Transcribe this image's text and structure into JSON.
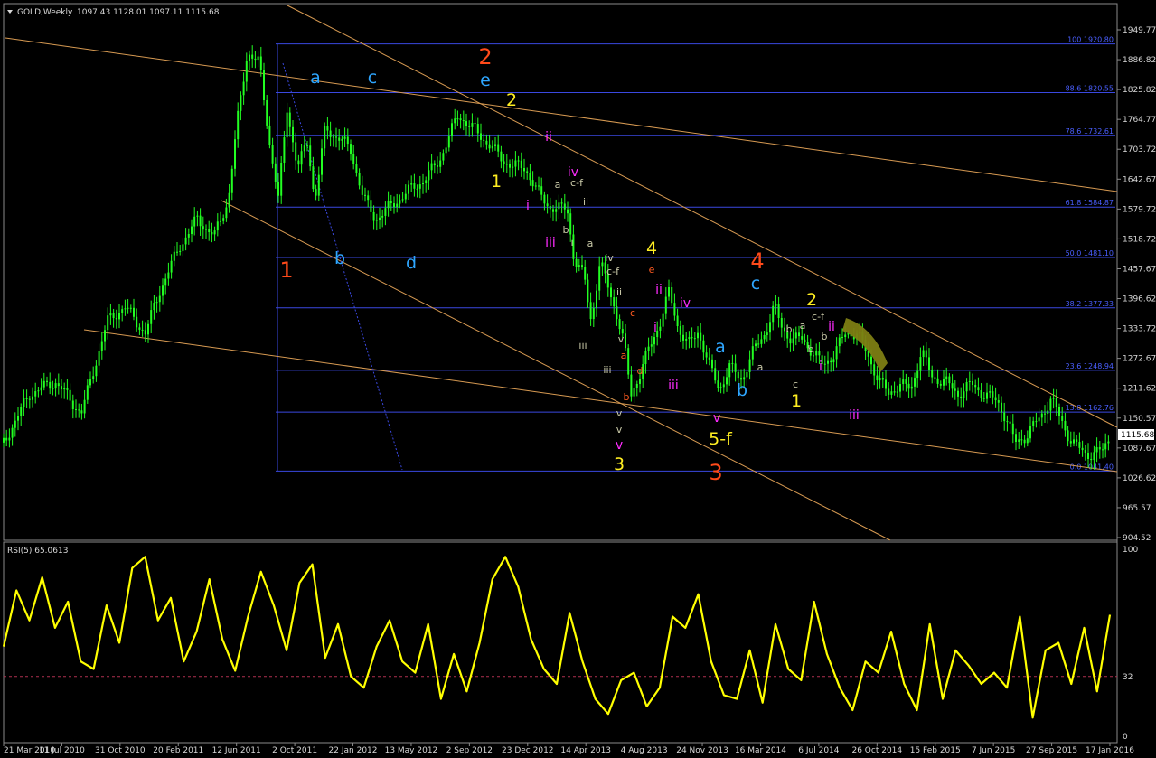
{
  "header": {
    "symbol_title": "GOLD,Weekly",
    "ohlc": "1097.43 1128.01 1097.11 1115.68"
  },
  "rsi_header": "RSI(5) 65.0613",
  "current_price": "1115.68",
  "chart_data": [
    {
      "type": "candlestick",
      "title": "GOLD,Weekly",
      "ylim": [
        904.52,
        1980
      ],
      "y_ticks": [
        "1949.77",
        "1886.82",
        "1825.82",
        "1764.77",
        "1703.72",
        "1642.67",
        "1579.72",
        "1518.72",
        "1457.67",
        "1396.62",
        "1333.72",
        "1272.67",
        "1211.62",
        "1150.57",
        "1087.67",
        "1026.62",
        "965.57",
        "904.52"
      ],
      "x_ticks": [
        "21 Mar 2010",
        "11 Jul 2010",
        "31 Oct 2010",
        "20 Feb 2011",
        "12 Jun 2011",
        "2 Oct 2011",
        "22 Jan 2012",
        "13 May 2012",
        "2 Sep 2012",
        "23 Dec 2012",
        "14 Apr 2013",
        "4 Aug 2013",
        "24 Nov 2013",
        "16 Mar 2014",
        "6 Jul 2014",
        "26 Oct 2014",
        "15 Feb 2015",
        "7 Jun 2015",
        "27 Sep 2015",
        "17 Jan 2016"
      ],
      "price_path": [
        [
          0,
          1100
        ],
        [
          1.5,
          1200
        ],
        [
          3,
          1225
        ],
        [
          4.5,
          1160
        ],
        [
          6,
          1350
        ],
        [
          7,
          1380
        ],
        [
          8.2,
          1325
        ],
        [
          9,
          1410
        ],
        [
          10.2,
          1505
        ],
        [
          11.2,
          1560
        ],
        [
          12.2,
          1525
        ],
        [
          13,
          1600
        ],
        [
          13.5,
          1755
        ],
        [
          14.1,
          1905
        ],
        [
          14.8,
          1880
        ],
        [
          15.4,
          1715
        ],
        [
          15.9,
          1600
        ],
        [
          16.4,
          1790
        ],
        [
          17,
          1665
        ],
        [
          17.6,
          1720
        ],
        [
          18,
          1595
        ],
        [
          18.6,
          1745
        ],
        [
          19.5,
          1725
        ],
        [
          20.1,
          1700
        ],
        [
          20.8,
          1605
        ],
        [
          21.5,
          1560
        ],
        [
          22.5,
          1590
        ],
        [
          23.5,
          1620
        ],
        [
          24.3,
          1640
        ],
        [
          25.2,
          1680
        ],
        [
          26.3,
          1775
        ],
        [
          27.2,
          1745
        ],
        [
          28.2,
          1710
        ],
        [
          28.9,
          1680
        ],
        [
          29.5,
          1670
        ],
        [
          30.2,
          1665
        ],
        [
          30.9,
          1615
        ],
        [
          31.6,
          1585
        ],
        [
          32.2,
          1580
        ],
        [
          32.6,
          1585
        ],
        [
          33,
          1475
        ],
        [
          33.6,
          1440
        ],
        [
          34,
          1350
        ],
        [
          34.5,
          1470
        ],
        [
          35,
          1420
        ],
        [
          35.5,
          1360
        ],
        [
          35.9,
          1300
        ],
        [
          36.3,
          1200
        ],
        [
          36.8,
          1240
        ],
        [
          37.4,
          1300
        ],
        [
          38,
          1350
        ],
        [
          38.5,
          1410
        ],
        [
          39,
          1340
        ],
        [
          39.6,
          1300
        ],
        [
          40.2,
          1330
        ],
        [
          40.8,
          1260
        ],
        [
          41.4,
          1210
        ],
        [
          42,
          1255
        ],
        [
          42.7,
          1230
        ],
        [
          43.4,
          1290
        ],
        [
          44.1,
          1330
        ],
        [
          44.6,
          1380
        ],
        [
          45,
          1340
        ],
        [
          45.6,
          1310
        ],
        [
          46.2,
          1315
        ],
        [
          46.8,
          1285
        ],
        [
          47.4,
          1260
        ],
        [
          48,
          1280
        ],
        [
          48.7,
          1325
        ],
        [
          49.4,
          1325
        ],
        [
          50,
          1280
        ],
        [
          50.6,
          1230
        ],
        [
          51.2,
          1200
        ],
        [
          51.8,
          1220
        ],
        [
          52.5,
          1210
        ],
        [
          53.1,
          1290
        ],
        [
          53.7,
          1235
        ],
        [
          54.5,
          1225
        ],
        [
          55.2,
          1200
        ],
        [
          56,
          1220
        ],
        [
          56.7,
          1200
        ],
        [
          57.5,
          1185
        ],
        [
          58,
          1150
        ],
        [
          58.5,
          1100
        ],
        [
          59.2,
          1115
        ],
        [
          60,
          1155
        ],
        [
          60.6,
          1190
        ],
        [
          61.2,
          1145
        ],
        [
          61.8,
          1100
        ],
        [
          62.5,
          1080
        ],
        [
          63,
          1075
        ],
        [
          63.6,
          1085
        ],
        [
          64,
          1115
        ]
      ],
      "fib_levels": [
        {
          "label": "100 1920.80",
          "price": 1920.8
        },
        {
          "label": "88.6 1820.55",
          "price": 1820.55
        },
        {
          "label": "78.6 1732.61",
          "price": 1732.61
        },
        {
          "label": "61.8 1584.87",
          "price": 1584.87
        },
        {
          "label": "50.0 1481.10",
          "price": 1481.1
        },
        {
          "label": "38.2 1377.33",
          "price": 1377.33
        },
        {
          "label": "23.6 1248.94",
          "price": 1248.94
        },
        {
          "label": "13.8 1162.76",
          "price": 1162.76
        },
        {
          "label": "0.0 1041.40",
          "price": 1041.4
        }
      ],
      "wave_labels": [
        {
          "t": "1",
          "c": "#ff4a1a",
          "s": "big",
          "x": 317,
          "y": 307
        },
        {
          "t": "2",
          "c": "#ff4a1a",
          "s": "big",
          "x": 537,
          "y": 71
        },
        {
          "t": "3",
          "c": "#ff4a1a",
          "s": "big",
          "x": 792,
          "y": 531
        },
        {
          "t": "4",
          "c": "#ff4a1a",
          "s": "big",
          "x": 838,
          "y": 297
        },
        {
          "t": "a",
          "c": "#2ea6ff",
          "s": "med",
          "x": 349,
          "y": 92
        },
        {
          "t": "c",
          "c": "#2ea6ff",
          "s": "med",
          "x": 412,
          "y": 92
        },
        {
          "t": "b",
          "c": "#2ea6ff",
          "s": "med",
          "x": 376,
          "y": 292
        },
        {
          "t": "d",
          "c": "#2ea6ff",
          "s": "med",
          "x": 455,
          "y": 297
        },
        {
          "t": "e",
          "c": "#2ea6ff",
          "s": "med",
          "x": 537,
          "y": 95
        },
        {
          "t": "c",
          "c": "#2ea6ff",
          "s": "med",
          "x": 836,
          "y": 320
        },
        {
          "t": "a",
          "c": "#2ea6ff",
          "s": "med",
          "x": 797,
          "y": 390
        },
        {
          "t": "b",
          "c": "#2ea6ff",
          "s": "med",
          "x": 821,
          "y": 438
        },
        {
          "t": "2",
          "c": "#ffee22",
          "s": "med",
          "x": 566,
          "y": 117
        },
        {
          "t": "1",
          "c": "#ffee22",
          "s": "med",
          "x": 549,
          "y": 207
        },
        {
          "t": "4",
          "c": "#ffee22",
          "s": "med",
          "x": 721,
          "y": 281
        },
        {
          "t": "3",
          "c": "#ffee22",
          "s": "med",
          "x": 685,
          "y": 520
        },
        {
          "t": "5-f",
          "c": "#ffee22",
          "s": "med",
          "x": 797,
          "y": 492
        },
        {
          "t": "2",
          "c": "#ffee22",
          "s": "med",
          "x": 898,
          "y": 338
        },
        {
          "t": "1",
          "c": "#ffee22",
          "s": "med",
          "x": 881,
          "y": 450
        },
        {
          "t": "ii",
          "c": "#ff2bff",
          "s": "n",
          "x": 607,
          "y": 156
        },
        {
          "t": "iv",
          "c": "#ff2bff",
          "s": "n",
          "x": 634,
          "y": 195
        },
        {
          "t": "i",
          "c": "#ff2bff",
          "s": "n",
          "x": 584,
          "y": 232
        },
        {
          "t": "iii",
          "c": "#ff2bff",
          "s": "n",
          "x": 609,
          "y": 273
        },
        {
          "t": "ii",
          "c": "#ff2bff",
          "s": "n",
          "x": 729,
          "y": 325
        },
        {
          "t": "iv",
          "c": "#ff2bff",
          "s": "n",
          "x": 758,
          "y": 340
        },
        {
          "t": "i",
          "c": "#ff2bff",
          "s": "n",
          "x": 725,
          "y": 367
        },
        {
          "t": "iii",
          "c": "#ff2bff",
          "s": "n",
          "x": 745,
          "y": 431
        },
        {
          "t": "v",
          "c": "#ff2bff",
          "s": "n",
          "x": 793,
          "y": 467
        },
        {
          "t": "v",
          "c": "#ff2bff",
          "s": "n",
          "x": 685,
          "y": 497
        },
        {
          "t": "ii",
          "c": "#ff2bff",
          "s": "n",
          "x": 920,
          "y": 366
        },
        {
          "t": "i",
          "c": "#ff2bff",
          "s": "n",
          "x": 908,
          "y": 410
        },
        {
          "t": "iii",
          "c": "#ff2bff",
          "s": "n",
          "x": 945,
          "y": 464
        },
        {
          "t": "a",
          "c": "#ccccaa",
          "s": "sm",
          "x": 617,
          "y": 208
        },
        {
          "t": "c-f",
          "c": "#ccccaa",
          "s": "sm",
          "x": 638,
          "y": 206
        },
        {
          "t": "ii",
          "c": "#ccccaa",
          "s": "sm",
          "x": 648,
          "y": 227
        },
        {
          "t": "b",
          "c": "#ccccaa",
          "s": "sm",
          "x": 626,
          "y": 258
        },
        {
          "t": "i",
          "c": "#ccccaa",
          "s": "sm",
          "x": 633,
          "y": 272
        },
        {
          "t": "a",
          "c": "#ccccaa",
          "s": "sm",
          "x": 653,
          "y": 273
        },
        {
          "t": "iv",
          "c": "#ccccaa",
          "s": "sm",
          "x": 674,
          "y": 289
        },
        {
          "t": "c-f",
          "c": "#ccccaa",
          "s": "sm",
          "x": 678,
          "y": 304
        },
        {
          "t": "ii",
          "c": "#ccccaa",
          "s": "sm",
          "x": 685,
          "y": 327
        },
        {
          "t": "iii",
          "c": "#ccccaa",
          "s": "sm",
          "x": 645,
          "y": 386
        },
        {
          "t": "v",
          "c": "#ccccaa",
          "s": "sm",
          "x": 687,
          "y": 379
        },
        {
          "t": "iii",
          "c": "#ccccaa",
          "s": "sm",
          "x": 672,
          "y": 413
        },
        {
          "t": "v",
          "c": "#ccccaa",
          "s": "sm",
          "x": 685,
          "y": 461
        },
        {
          "t": "v",
          "c": "#ccccaa",
          "s": "sm",
          "x": 685,
          "y": 479
        },
        {
          "t": "e",
          "c": "#ff5a20",
          "s": "sm",
          "x": 721,
          "y": 302
        },
        {
          "t": "c",
          "c": "#ff5a20",
          "s": "sm",
          "x": 700,
          "y": 350
        },
        {
          "t": "a",
          "c": "#ff5a20",
          "s": "sm",
          "x": 690,
          "y": 397
        },
        {
          "t": "d",
          "c": "#ff5a20",
          "s": "sm",
          "x": 708,
          "y": 414
        },
        {
          "t": "b",
          "c": "#ff5a20",
          "s": "sm",
          "x": 693,
          "y": 443
        },
        {
          "t": "a",
          "c": "#ccccaa",
          "s": "sm",
          "x": 841,
          "y": 410
        },
        {
          "t": "b",
          "c": "#ccccaa",
          "s": "sm",
          "x": 873,
          "y": 368
        },
        {
          "t": "a",
          "c": "#ccccaa",
          "s": "sm",
          "x": 888,
          "y": 364
        },
        {
          "t": "c-f",
          "c": "#ccccaa",
          "s": "sm",
          "x": 905,
          "y": 354
        },
        {
          "t": "b",
          "c": "#ccccaa",
          "s": "sm",
          "x": 897,
          "y": 390
        },
        {
          "t": "b",
          "c": "#ccccaa",
          "s": "sm",
          "x": 912,
          "y": 376
        },
        {
          "t": "c",
          "c": "#ccccaa",
          "s": "sm",
          "x": 880,
          "y": 429
        }
      ]
    },
    {
      "type": "line",
      "title": "RSI(5) 65.0613",
      "ylim": [
        0,
        100
      ],
      "y_ticks": [
        "100",
        "32",
        "0"
      ],
      "reference_line": 32,
      "series": [
        {
          "name": "RSI(5)",
          "color": "#ffff00",
          "values": [
            48,
            78,
            62,
            85,
            58,
            72,
            40,
            36,
            70,
            50,
            90,
            96,
            62,
            74,
            40,
            56,
            84,
            52,
            35,
            64,
            88,
            70,
            46,
            82,
            92,
            42,
            60,
            32,
            26,
            48,
            62,
            40,
            34,
            60,
            20,
            44,
            24,
            50,
            84,
            96,
            80,
            52,
            36,
            28,
            66,
            40,
            20,
            12,
            30,
            34,
            16,
            26,
            64,
            58,
            76,
            40,
            22,
            20,
            46,
            18,
            60,
            36,
            30,
            72,
            44,
            26,
            14,
            40,
            34,
            56,
            28,
            14,
            60,
            20,
            46,
            38,
            28,
            34,
            26,
            64,
            10,
            46,
            50,
            28,
            58,
            24,
            65
          ]
        }
      ]
    }
  ]
}
